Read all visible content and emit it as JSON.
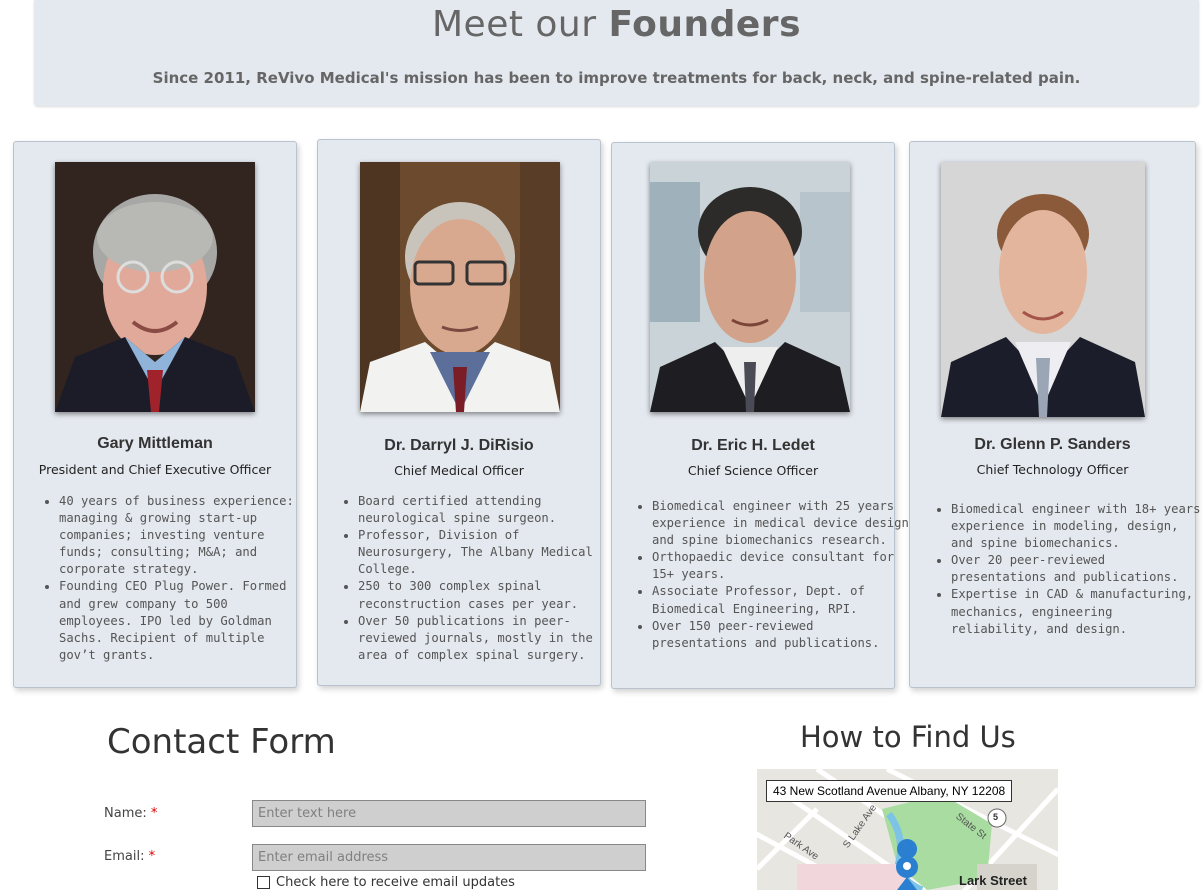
{
  "header": {
    "title_part1": "Meet our ",
    "title_part2": "Founders",
    "subtitle": "Since 2011, ReVivo Medical's mission has been to improve treatments for back, neck, and spine-related pain."
  },
  "founders": [
    {
      "name": "Gary Mittleman",
      "role": "President and Chief Executive Officer",
      "bullets": [
        "40 years of business experience: managing & growing start-up companies; investing venture funds; consulting; M&A; and corporate strategy.",
        "Founding CEO Plug Power. Formed and grew company to 500 employees. IPO led by Goldman Sachs. Recipient of multiple gov’t grants."
      ]
    },
    {
      "name": "Dr. Darryl J. DiRisio",
      "role": "Chief Medical Officer",
      "bullets": [
        "Board certified attending neurological spine surgeon.",
        "Professor, Division of Neurosurgery, The Albany Medical College.",
        "250 to 300 complex spinal reconstruction cases per year.",
        "Over 50 publications in peer-reviewed journals, mostly in the area of complex spinal surgery."
      ]
    },
    {
      "name": "Dr. Eric H. Ledet",
      "role": "Chief Science Officer",
      "bullets": [
        "Biomedical engineer with 25 years experience in medical device design and spine biomechanics research.",
        "Orthopaedic device consultant for 15+ years.",
        "Associate Professor, Dept. of Biomedical Engineering, RPI.",
        "Over 150 peer-reviewed presentations and publications."
      ]
    },
    {
      "name": "Dr. Glenn P. Sanders",
      "role": "Chief Technology Officer",
      "bullets": [
        "Biomedical engineer with 18+ years experience in modeling, design, and spine biomechanics.",
        "Over 20 peer-reviewed presentations and publications.",
        "Expertise in CAD & manufacturing, mechanics, engineering reliability, and design."
      ]
    }
  ],
  "contact": {
    "title": "Contact Form",
    "name_label": "Name:",
    "name_placeholder": "Enter text here",
    "email_label": "Email:",
    "email_placeholder": "Enter email address",
    "required_mark": "*",
    "checkbox_label": "Check here to receive email updates"
  },
  "map": {
    "title": "How to Find Us",
    "address": "43 New Scotland Avenue Albany, NY 12208",
    "streets": [
      "Park Ave",
      "S Lake Ave",
      "State St",
      "Lark Street"
    ],
    "route_badge": "5"
  },
  "colors": {
    "card_bg": "#e4e9ef",
    "required": "#dd0000",
    "map_park": "#a8dca0",
    "map_pin": "#2a7fd0"
  }
}
